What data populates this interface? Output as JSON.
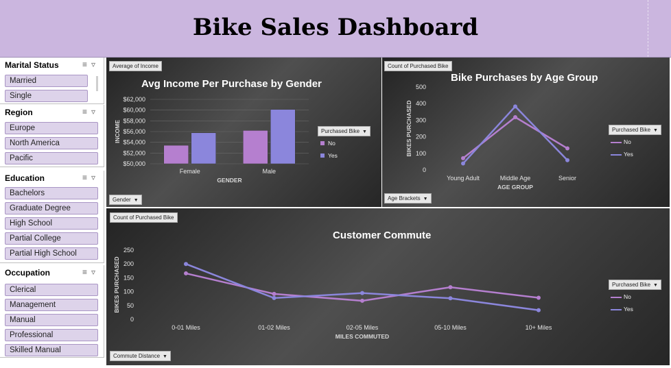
{
  "dashboard": {
    "title": "Bike Sales Dashboard"
  },
  "slicers": [
    {
      "title": "Marital Status",
      "items": [
        "Married",
        "Single"
      ]
    },
    {
      "title": "Region",
      "items": [
        "Europe",
        "North America",
        "Pacific"
      ]
    },
    {
      "title": "Education",
      "items": [
        "Bachelors",
        "Graduate Degree",
        "High School",
        "Partial College",
        "Partial High School"
      ]
    },
    {
      "title": "Occupation",
      "items": [
        "Clerical",
        "Management",
        "Manual",
        "Professional",
        "Skilled Manual"
      ]
    }
  ],
  "income_chart": {
    "field_value": "Average of Income",
    "field_axis": "Gender",
    "legend_title": "Purchased Bike",
    "legend": [
      "No",
      "Yes"
    ]
  },
  "age_chart": {
    "field_value": "Count of Purchased Bike",
    "field_axis": "Age Brackets",
    "legend_title": "Purchased Bike",
    "legend": [
      "No",
      "Yes"
    ]
  },
  "commute_chart": {
    "field_value": "Count of Purchased Bike",
    "field_axis": "Commute Distance",
    "legend_title": "Purchased Bike",
    "legend": [
      "No",
      "Yes"
    ]
  },
  "colors": {
    "no": "#b57fcf",
    "yes": "#8b86dc",
    "header_bg": "#cbb6df",
    "slicer_item": "#ddd3ea"
  },
  "chart_data": [
    {
      "type": "bar",
      "title": "Avg Income Per Purchase by Gender",
      "xlabel": "GENDER",
      "ylabel": "INCOME",
      "categories": [
        "Female",
        "Male"
      ],
      "series": [
        {
          "name": "No",
          "values": [
            53440,
            56208
          ]
        },
        {
          "name": "Yes",
          "values": [
            55774,
            60124
          ]
        }
      ],
      "ylim": [
        50000,
        62000
      ],
      "yticks": [
        "$50,000",
        "$52,000",
        "$54,000",
        "$56,000",
        "$58,000",
        "$60,000",
        "$62,000"
      ],
      "grid": true,
      "legend_position": "right"
    },
    {
      "type": "line",
      "title": "Bike Purchases by Age Group",
      "xlabel": "AGE GROUP",
      "ylabel": "BIKES PURCHASED",
      "categories": [
        "Young Adult",
        "Middle Age",
        "Senior"
      ],
      "series": [
        {
          "name": "No",
          "values": [
            71,
            318,
            130
          ]
        },
        {
          "name": "Yes",
          "values": [
            39,
            383,
            59
          ]
        }
      ],
      "ylim": [
        0,
        500
      ],
      "yticks": [
        "0",
        "100",
        "200",
        "300",
        "400",
        "500"
      ],
      "grid": false,
      "legend_position": "right"
    },
    {
      "type": "line",
      "title": "Customer Commute",
      "xlabel": "MILES COMMUTED",
      "ylabel": "BIKES PURCHASED",
      "categories": [
        "0-01 Miles",
        "01-02 Miles",
        "02-05 Miles",
        "05-10 Miles",
        "10+ Miles"
      ],
      "series": [
        {
          "name": "No",
          "values": [
            166,
            92,
            67,
            116,
            78
          ]
        },
        {
          "name": "Yes",
          "values": [
            200,
            77,
            95,
            76,
            33
          ]
        }
      ],
      "ylim": [
        0,
        250
      ],
      "yticks": [
        "0",
        "50",
        "100",
        "150",
        "200",
        "250"
      ],
      "grid": false,
      "legend_position": "right"
    }
  ]
}
